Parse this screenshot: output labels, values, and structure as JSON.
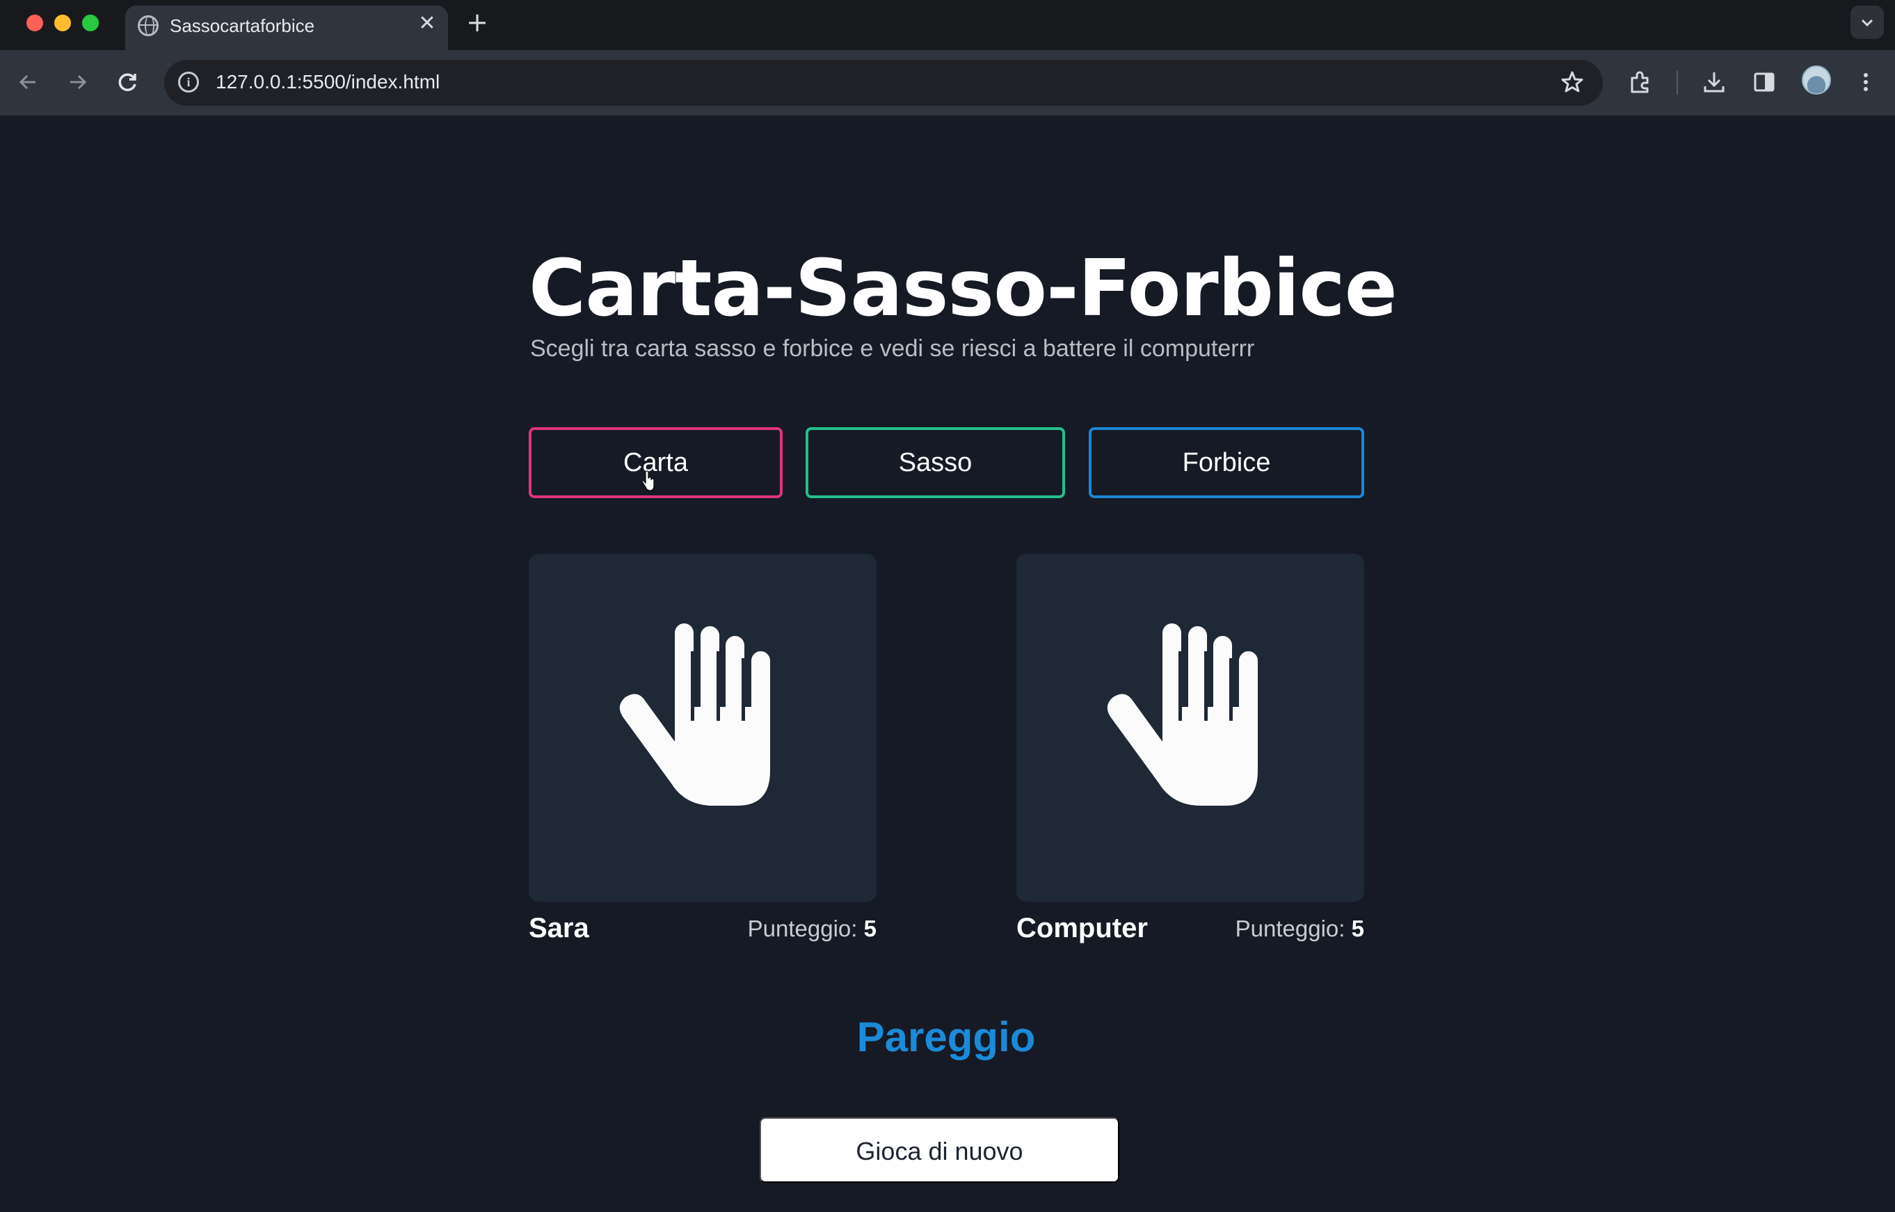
{
  "browser": {
    "tab_title": "Sassocartaforbice",
    "tab_close": "✕",
    "new_tab": "+",
    "url": "127.0.0.1:5500/index.html"
  },
  "game": {
    "title": "Carta-Sasso-Forbice",
    "subtitle": "Scegli tra carta sasso e forbice e vedi se riesci a battere il computerrr",
    "choices": [
      {
        "label": "Carta",
        "color": "#e0347a"
      },
      {
        "label": "Sasso",
        "color": "#22c08a"
      },
      {
        "label": "Forbice",
        "color": "#1a86d6"
      }
    ],
    "player": {
      "name": "Sara",
      "score_label": "Punteggio:",
      "score": "5",
      "hand_icon": "hand-paper-icon"
    },
    "computer": {
      "name": "Computer",
      "score_label": "Punteggio:",
      "score": "5",
      "hand_icon": "hand-paper-icon"
    },
    "result": "Pareggio",
    "result_color": "#1b8ad8",
    "replay_label": "Gioca di nuovo"
  }
}
